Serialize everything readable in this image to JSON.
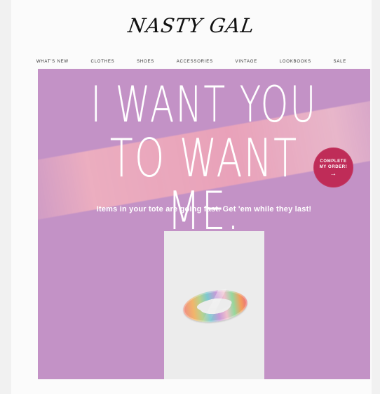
{
  "brand": {
    "logo_text": "NASTY GAL"
  },
  "navigation": [
    {
      "label": "WHAT'S NEW"
    },
    {
      "label": "CLOTHES"
    },
    {
      "label": "SHOES"
    },
    {
      "label": "ACCESSORIES"
    },
    {
      "label": "VINTAGE"
    },
    {
      "label": "LOOKBOOKS"
    },
    {
      "label": "SALE"
    }
  ],
  "hero": {
    "headline_line_1": "I WANT YOU",
    "headline_line_2": "TO WANT ME.",
    "subline": "Items in your tote are going fast. Get 'em while they last!",
    "badge_line_1": "COMPLETE",
    "badge_line_2": "MY ORDER!",
    "badge_arrow": "→",
    "background_color": "#c392c6",
    "badge_color": "#bf2c58"
  },
  "product": {
    "image_icon": "ring-icon"
  }
}
